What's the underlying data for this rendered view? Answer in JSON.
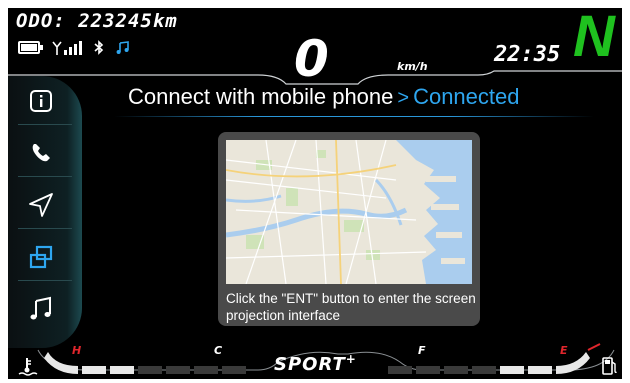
{
  "odometer": "ODO: 223245km",
  "speed": "0",
  "speed_unit": "km/h",
  "clock": "22:35",
  "gear": "N",
  "heading": {
    "title": "Connect with mobile phone",
    "separator": ">",
    "status": "Connected"
  },
  "caption": "Click the \"ENT\" button to enter the screen projection interface",
  "sidebar": {
    "items": [
      {
        "icon": "info-icon",
        "active": false
      },
      {
        "icon": "phone-icon",
        "active": false
      },
      {
        "icon": "navigation-icon",
        "active": false
      },
      {
        "icon": "screen-projection-icon",
        "active": true
      },
      {
        "icon": "music-icon",
        "active": false
      }
    ]
  },
  "temp_gauge": {
    "hot_label": "H",
    "cold_label": "C"
  },
  "fuel_gauge": {
    "full_label": "F",
    "empty_label": "E"
  },
  "ride_mode": "SPORT",
  "ride_mode_suffix": "+",
  "colors": {
    "accent": "#2ea6ef",
    "gear": "#1fc11f",
    "warning": "#e0262c"
  }
}
